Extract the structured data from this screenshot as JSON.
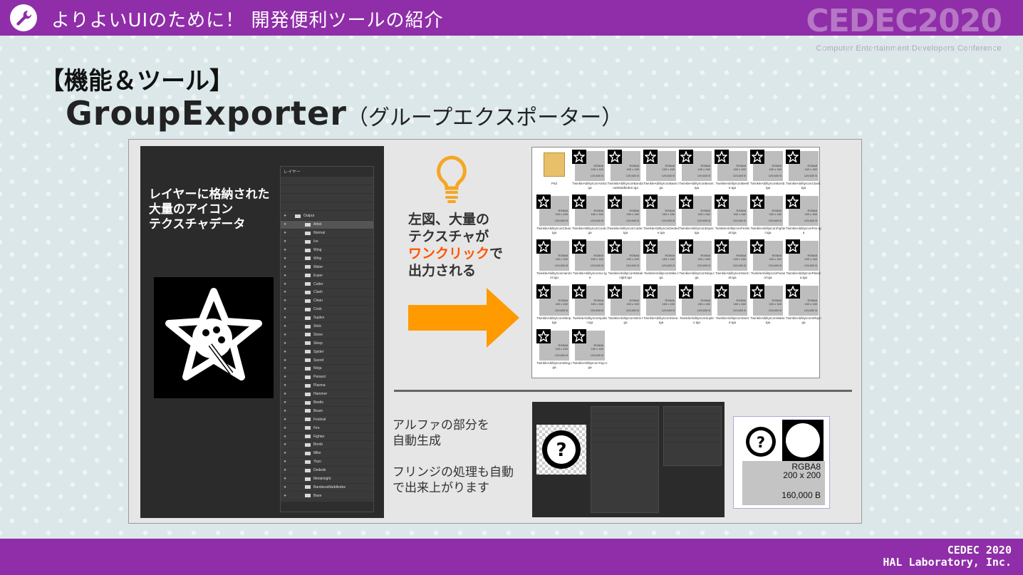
{
  "header": {
    "title": "よりよいUIのために！ 開発便利ツールの紹介",
    "logo": "CEDEC2020",
    "logo_sub": "Computer Entertainment Developers Conference"
  },
  "slide": {
    "section": "【機能＆ツール】",
    "title_en": "GroupExporter",
    "title_jp": "（グループエクスポーター）"
  },
  "left_caption": [
    "レイヤーに格納された",
    "大量のアイコン",
    "テクスチャデータ"
  ],
  "layers_panel": {
    "tab": "レイヤー",
    "root": "Output",
    "items": [
      "Artist",
      "Normal",
      "Ice",
      "Wing",
      "Whip",
      "Water",
      "Esper",
      "Cutter",
      "Clash",
      "Clean",
      "Cook",
      "Suplex",
      "Stick",
      "Stone",
      "Sleep",
      "Spider",
      "Sword",
      "Ninja",
      "Parasol",
      "Plasma",
      "Hammer",
      "Beetle",
      "Beam",
      "Festival",
      "Fire",
      "Fighter",
      "Bomb",
      "Mike",
      "Yoyo",
      "Dedede",
      "Metaknight",
      "BandanaWaddledee",
      "Base"
    ]
  },
  "mid_text": {
    "line1": "左図、大量の",
    "line2": "テクスチャが",
    "highlight": "ワンクリック",
    "line3_tail": "で",
    "line4": "出力される"
  },
  "explorer": {
    "files": [
      {
        "name": "Psd",
        "folder": true
      },
      {
        "name": "TwinkleAbilityIconArtist.tga"
      },
      {
        "name": "TwinkleAbilityIconBandanaWaddledee.tga"
      },
      {
        "name": "TwinkleAbilityIconBase.tga"
      },
      {
        "name": "TwinkleAbilityIconBeam.tga"
      },
      {
        "name": "TwinkleAbilityIconBeetle.tga"
      },
      {
        "name": "TwinkleAbilityIconBomb.tga"
      },
      {
        "name": "TwinkleAbilityIconClash.tga"
      },
      {
        "name": "TwinkleAbilityIconClean.tga"
      },
      {
        "name": "TwinkleAbilityIconCook.tga"
      },
      {
        "name": "TwinkleAbilityIconCutter.tga"
      },
      {
        "name": "TwinkleAbilityIconDedede.tga"
      },
      {
        "name": "TwinkleAbilityIconEsper.tga"
      },
      {
        "name": "TwinkleAbilityIconFestival.tga"
      },
      {
        "name": "TwinkleAbilityIconFighter.tga"
      },
      {
        "name": "TwinkleAbilityIconFire.tga"
      },
      {
        "name": "TwinkleAbilityIconHammer.tga"
      },
      {
        "name": "TwinkleAbilityIconIce.tga"
      },
      {
        "name": "TwinkleAbilityIconMetaknight.tga"
      },
      {
        "name": "TwinkleAbilityIconMike.tga"
      },
      {
        "name": "TwinkleAbilityIconNinja.tga"
      },
      {
        "name": "TwinkleAbilityIconNormal.tga"
      },
      {
        "name": "TwinkleAbilityIconParasol.tga"
      },
      {
        "name": "TwinkleAbilityIconPlasma.tga"
      },
      {
        "name": "TwinkleAbilityIconSleep.tga"
      },
      {
        "name": "TwinkleAbilityIconSpider.tga"
      },
      {
        "name": "TwinkleAbilityIconStick.tga"
      },
      {
        "name": "TwinkleAbilityIconStone.tga"
      },
      {
        "name": "TwinkleAbilityIconSuplex.tga"
      },
      {
        "name": "TwinkleAbilityIconSword.tga"
      },
      {
        "name": "TwinkleAbilityIconWater.tga"
      },
      {
        "name": "TwinkleAbilityIconWhip.tga"
      },
      {
        "name": "TwinkleAbilityIconWing.tga"
      },
      {
        "name": "TwinkleAbilityIconYoyo.tga"
      }
    ],
    "meta_format": "RGBA8",
    "meta_dims": "160 x 160",
    "meta_size": "129,600 B"
  },
  "bottom_text": [
    "アルファの部分を",
    "自動生成",
    "",
    "フリンジの処理も自動",
    "で出来上がります"
  ],
  "result": {
    "format": "RGBA8",
    "dims": "200 x 200",
    "size": "160,000 B"
  },
  "footer": {
    "line1": "CEDEC 2020",
    "line2": "HAL Laboratory, Inc."
  },
  "colors": {
    "bar": "#8f2ea8",
    "highlight": "#ff5400",
    "arrow": "#ff9a00",
    "bulb": "#f5a623"
  }
}
